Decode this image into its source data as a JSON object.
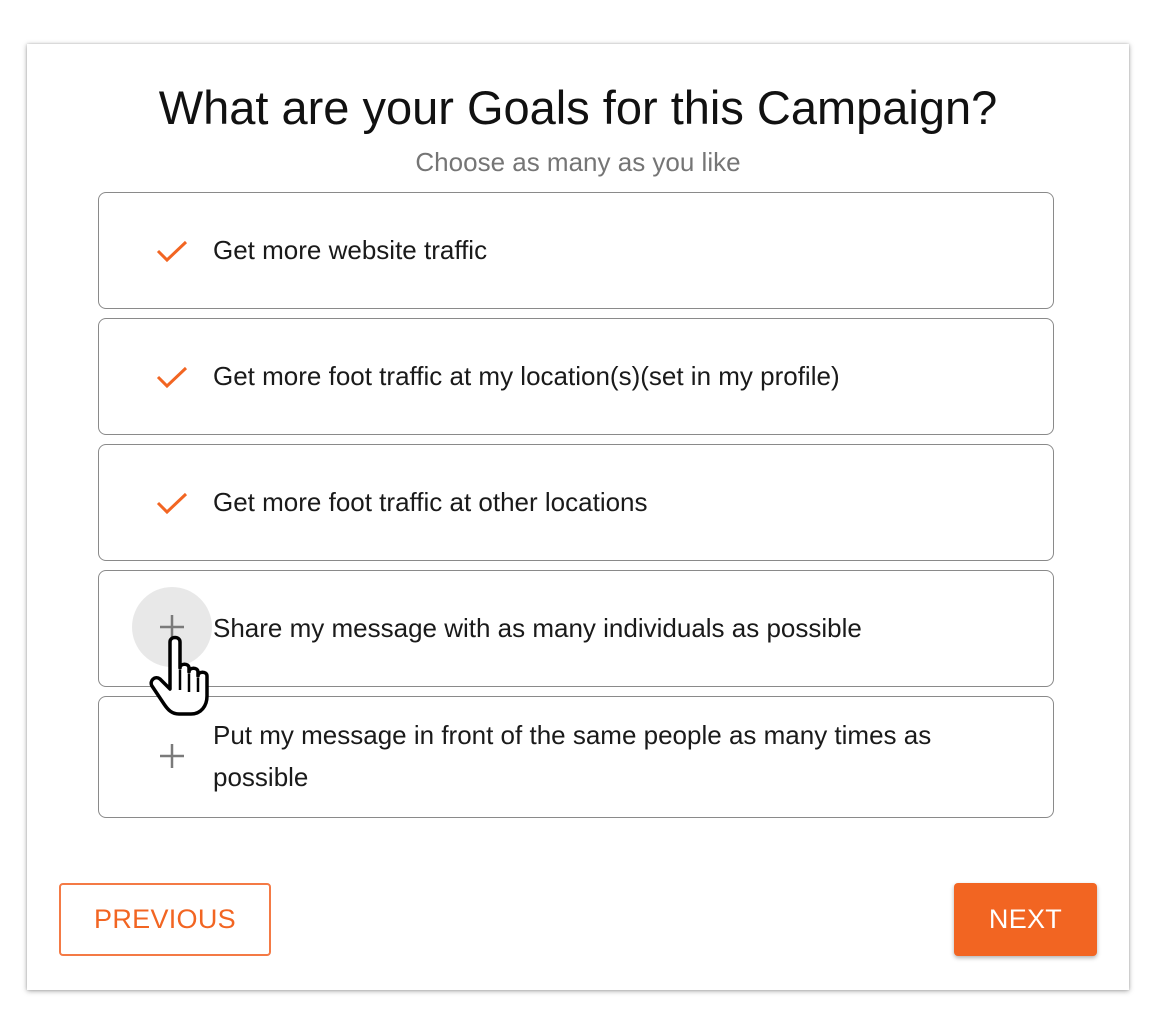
{
  "header": {
    "title": "What are your Goals for this Campaign?",
    "subtitle": "Choose as many as you like"
  },
  "goals": [
    {
      "label": "Get more website traffic",
      "selected": true,
      "icon": "check-icon"
    },
    {
      "label": "Get more foot traffic at my location(s)(set in my profile)",
      "selected": true,
      "icon": "check-icon"
    },
    {
      "label": "Get more foot traffic at other locations",
      "selected": true,
      "icon": "check-icon"
    },
    {
      "label": "Share my message with as many individuals as possible",
      "selected": false,
      "icon": "plus-icon"
    },
    {
      "label": "Put my message in front of the same people as many times as possible",
      "selected": false,
      "icon": "plus-icon"
    }
  ],
  "navigation": {
    "previous_label": "PREVIOUS",
    "next_label": "NEXT"
  },
  "colors": {
    "accent": "#f26522",
    "check": "#f26522",
    "plus": "#7a7a7a",
    "border": "#8a8a8a"
  }
}
